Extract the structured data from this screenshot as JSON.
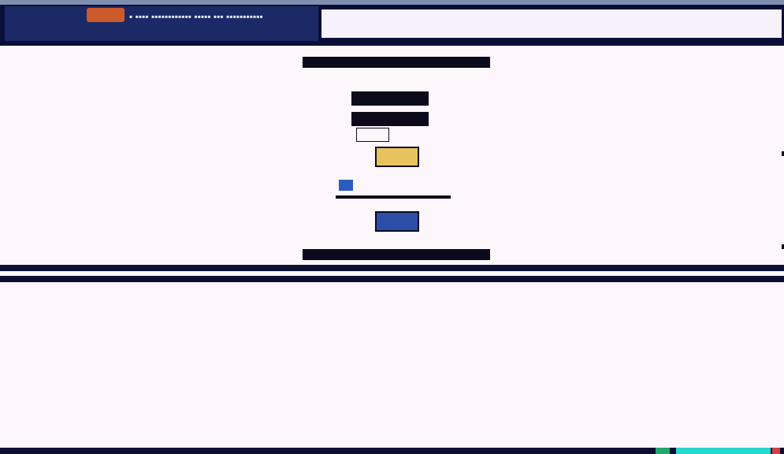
{
  "window": {
    "tab_text": "▪ ▪▪▪▪ ▪▪▪▪▪▪▪▪▪▪▪▪ ▪▪▪▪▪ ▪▪▪ ▪▪▪▪▪▪▪▪▪▪▪",
    "address_placeholder": ""
  },
  "login": {
    "header": "",
    "username_label": "",
    "password_label": "",
    "email_label": "",
    "remember_label": "",
    "login_button": "",
    "forgot_label": "",
    "new_user_label": "",
    "register_button": "",
    "footer": ""
  },
  "colors": {
    "titlebar": "#0a0f3a",
    "page": "#fdf6fb",
    "login_button": "#e8c35d",
    "register_button": "#2c4ea8",
    "status_green": "#20a86d",
    "status_cyan": "#27d8d0",
    "status_red": "#d1404a"
  }
}
